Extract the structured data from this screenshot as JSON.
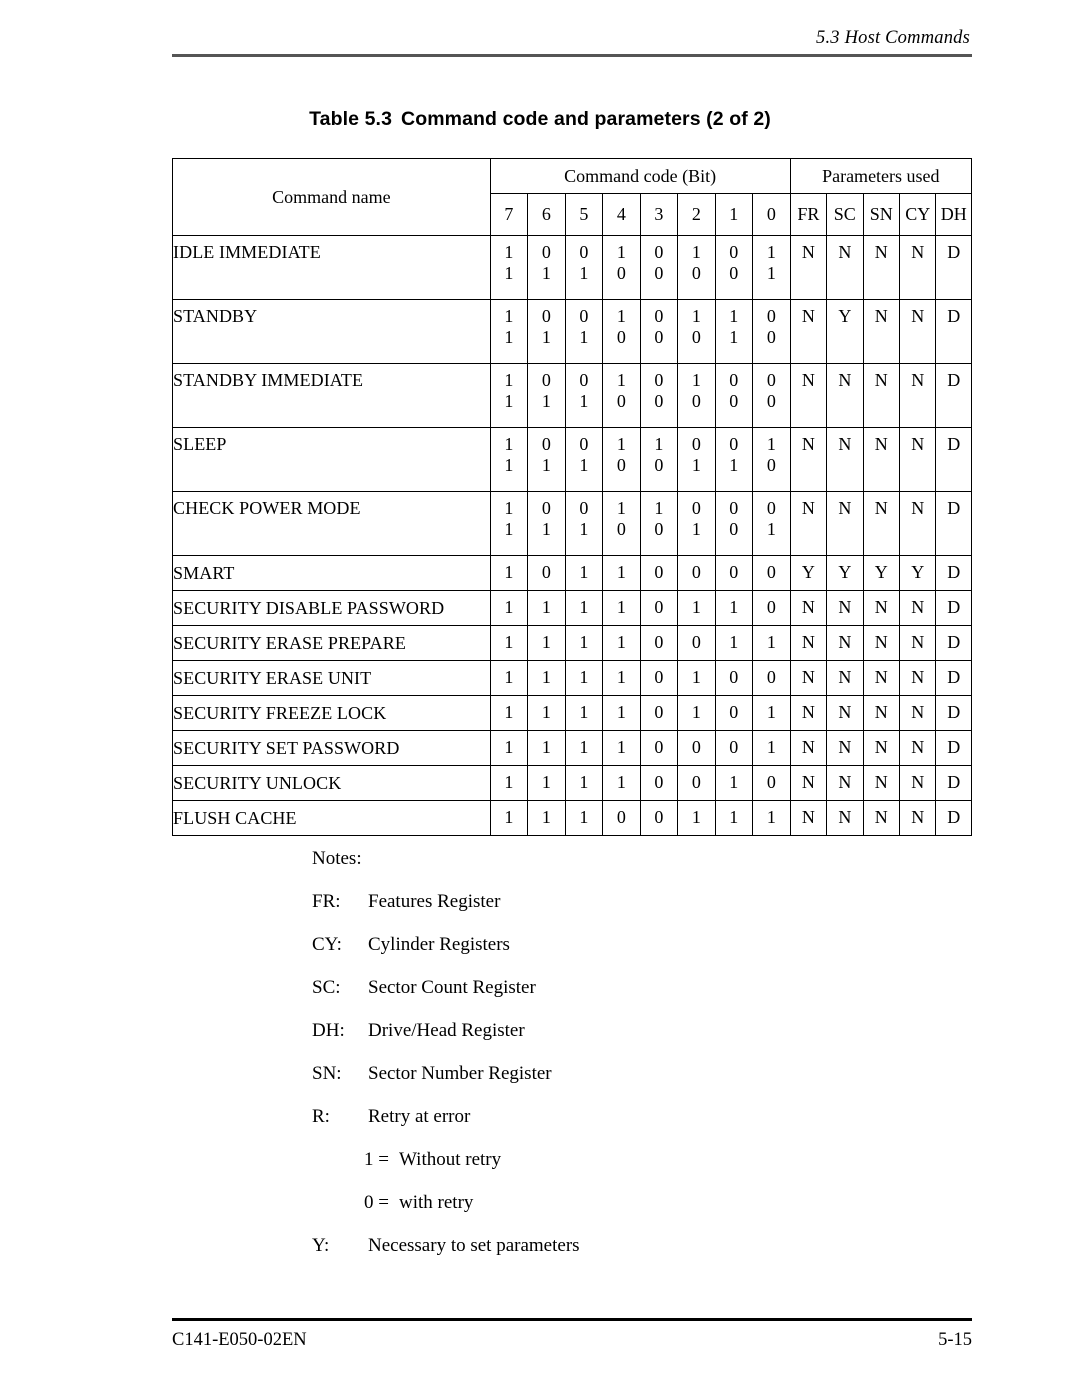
{
  "header": {
    "running_head": "5.3  Host Commands"
  },
  "caption": {
    "label": "Table 5.3",
    "text": "Command code and parameters (2 of 2)"
  },
  "table": {
    "name_header": "Command name",
    "group_headers": {
      "command_code": "Command code (Bit)",
      "parameters_used": "Parameters used"
    },
    "bit_headers": [
      "7",
      "6",
      "5",
      "4",
      "3",
      "2",
      "1",
      "0"
    ],
    "param_headers": [
      "FR",
      "SC",
      "SN",
      "CY",
      "DH"
    ],
    "rows": [
      {
        "name": "IDLE IMMEDIATE",
        "bits_line1": [
          "1",
          "0",
          "0",
          "1",
          "0",
          "1",
          "0",
          "1"
        ],
        "bits_line2": [
          "1",
          "1",
          "1",
          "0",
          "0",
          "0",
          "0",
          "1"
        ],
        "params": [
          "N",
          "N",
          "N",
          "N",
          "D"
        ]
      },
      {
        "name": "STANDBY",
        "bits_line1": [
          "1",
          "0",
          "0",
          "1",
          "0",
          "1",
          "1",
          "0"
        ],
        "bits_line2": [
          "1",
          "1",
          "1",
          "0",
          "0",
          "0",
          "1",
          "0"
        ],
        "params": [
          "N",
          "Y",
          "N",
          "N",
          "D"
        ]
      },
      {
        "name": "STANDBY IMMEDIATE",
        "bits_line1": [
          "1",
          "0",
          "0",
          "1",
          "0",
          "1",
          "0",
          "0"
        ],
        "bits_line2": [
          "1",
          "1",
          "1",
          "0",
          "0",
          "0",
          "0",
          "0"
        ],
        "params": [
          "N",
          "N",
          "N",
          "N",
          "D"
        ]
      },
      {
        "name": "SLEEP",
        "bits_line1": [
          "1",
          "0",
          "0",
          "1",
          "1",
          "0",
          "0",
          "1"
        ],
        "bits_line2": [
          "1",
          "1",
          "1",
          "0",
          "0",
          "1",
          "1",
          "0"
        ],
        "params": [
          "N",
          "N",
          "N",
          "N",
          "D"
        ]
      },
      {
        "name": "CHECK POWER MODE",
        "bits_line1": [
          "1",
          "0",
          "0",
          "1",
          "1",
          "0",
          "0",
          "0"
        ],
        "bits_line2": [
          "1",
          "1",
          "1",
          "0",
          "0",
          "1",
          "0",
          "1"
        ],
        "params": [
          "N",
          "N",
          "N",
          "N",
          "D"
        ]
      },
      {
        "name": "SMART",
        "bits_line1": [
          "1",
          "0",
          "1",
          "1",
          "0",
          "0",
          "0",
          "0"
        ],
        "bits_line2": null,
        "params": [
          "Y",
          "Y",
          "Y",
          "Y",
          "D"
        ]
      },
      {
        "name": "SECURITY DISABLE PASSWORD",
        "bits_line1": [
          "1",
          "1",
          "1",
          "1",
          "0",
          "1",
          "1",
          "0"
        ],
        "bits_line2": null,
        "params": [
          "N",
          "N",
          "N",
          "N",
          "D"
        ]
      },
      {
        "name": "SECURITY ERASE PREPARE",
        "bits_line1": [
          "1",
          "1",
          "1",
          "1",
          "0",
          "0",
          "1",
          "1"
        ],
        "bits_line2": null,
        "params": [
          "N",
          "N",
          "N",
          "N",
          "D"
        ]
      },
      {
        "name": "SECURITY ERASE UNIT",
        "bits_line1": [
          "1",
          "1",
          "1",
          "1",
          "0",
          "1",
          "0",
          "0"
        ],
        "bits_line2": null,
        "params": [
          "N",
          "N",
          "N",
          "N",
          "D"
        ]
      },
      {
        "name": "SECURITY FREEZE LOCK",
        "bits_line1": [
          "1",
          "1",
          "1",
          "1",
          "0",
          "1",
          "0",
          "1"
        ],
        "bits_line2": null,
        "params": [
          "N",
          "N",
          "N",
          "N",
          "D"
        ]
      },
      {
        "name": "SECURITY SET PASSWORD",
        "bits_line1": [
          "1",
          "1",
          "1",
          "1",
          "0",
          "0",
          "0",
          "1"
        ],
        "bits_line2": null,
        "params": [
          "N",
          "N",
          "N",
          "N",
          "D"
        ]
      },
      {
        "name": "SECURITY UNLOCK",
        "bits_line1": [
          "1",
          "1",
          "1",
          "1",
          "0",
          "0",
          "1",
          "0"
        ],
        "bits_line2": null,
        "params": [
          "N",
          "N",
          "N",
          "N",
          "D"
        ]
      },
      {
        "name": "FLUSH CACHE",
        "bits_line1": [
          "1",
          "1",
          "1",
          "0",
          "0",
          "1",
          "1",
          "1"
        ],
        "bits_line2": null,
        "params": [
          "N",
          "N",
          "N",
          "N",
          "D"
        ]
      }
    ]
  },
  "notes": {
    "title": "Notes:",
    "entries": [
      {
        "abbr": "FR:",
        "desc": "Features Register",
        "indent": false
      },
      {
        "abbr": "CY:",
        "desc": "Cylinder Registers",
        "indent": false
      },
      {
        "abbr": "SC:",
        "desc": "Sector Count Register",
        "indent": false
      },
      {
        "abbr": "DH:",
        "desc": "Drive/Head Register",
        "indent": false
      },
      {
        "abbr": "SN:",
        "desc": "Sector Number Register",
        "indent": false
      },
      {
        "abbr": "R:",
        "desc": "Retry at error",
        "indent": false
      },
      {
        "abbr": "1 =",
        "desc": "Without retry",
        "indent": true
      },
      {
        "abbr": "0 =",
        "desc": "with retry",
        "indent": true
      },
      {
        "abbr": "Y:",
        "desc": "Necessary to set parameters",
        "indent": false
      }
    ]
  },
  "footer": {
    "doc_number": "C141-E050-02EN",
    "page_number": "5-15"
  }
}
